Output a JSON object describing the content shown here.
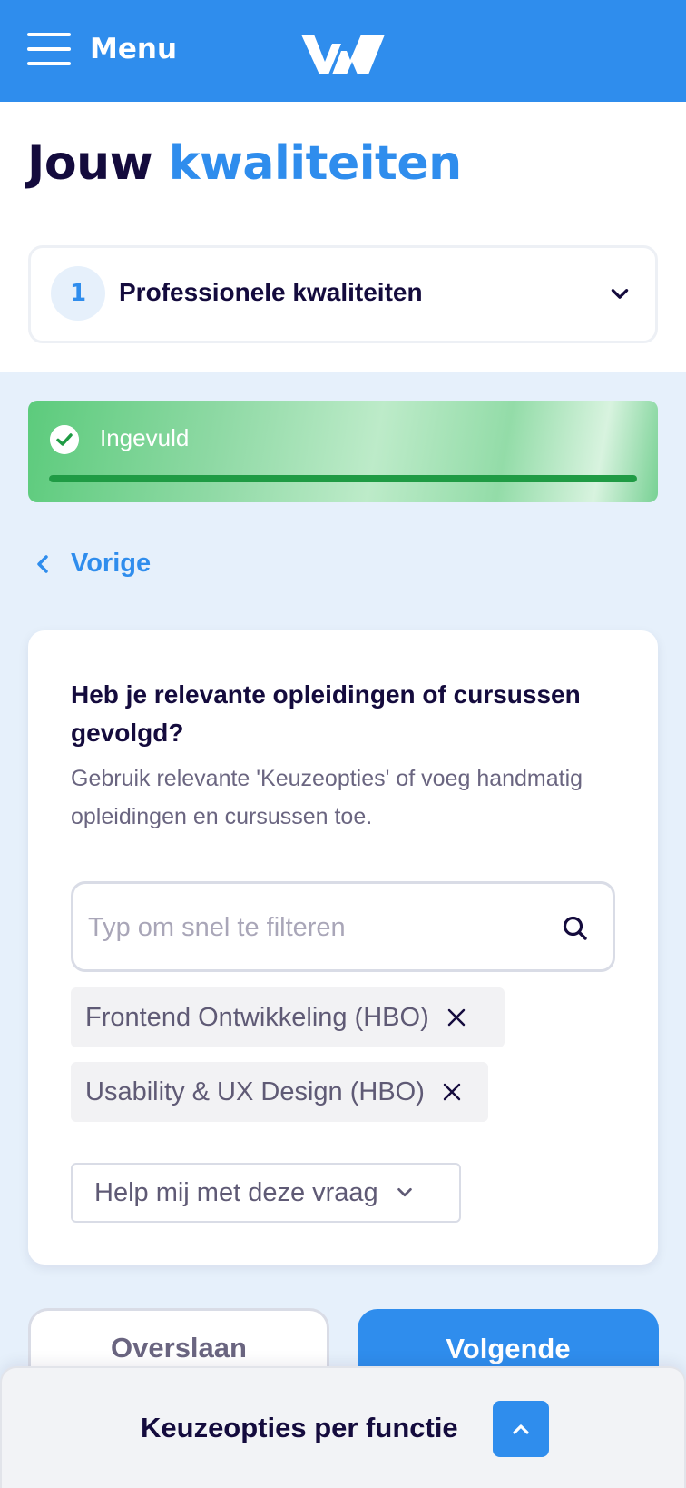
{
  "header": {
    "menu_label": "Menu",
    "menu_icon": "hamburger-icon",
    "logo": "brand-logo"
  },
  "page": {
    "title_part1": "Jouw",
    "title_part2": "kwaliteiten"
  },
  "step_selector": {
    "number": "1",
    "label": "Professionele kwaliteiten",
    "icon": "chevron-down-icon"
  },
  "status": {
    "label": "Ingevuld",
    "progress": 1.0,
    "icon": "check-circle-icon",
    "color": "#1f9b44"
  },
  "back": {
    "label": "Vorige",
    "icon": "chevron-left-icon"
  },
  "question": {
    "title": "Heb je relevante opleidingen of cursussen gevolgd?",
    "description": "Gebruik relevante 'Keuzeopties' of voeg handmatig opleidingen en cursussen toe.",
    "search_placeholder": "Typ om snel te filteren",
    "search_value": "",
    "search_icon": "search-icon",
    "selected": [
      "Frontend Ontwikkeling (HBO)",
      "Usability & UX Design (HBO)"
    ],
    "help_label": "Help mij met deze vraag"
  },
  "actions": {
    "skip_label": "Overslaan",
    "next_label": "Volgende"
  },
  "bottom_sheet": {
    "label": "Keuzeopties per functie",
    "icon": "chevron-up-icon"
  },
  "colors": {
    "primary": "#2f8ded",
    "navy": "#140b3d",
    "success": "#1f9b44",
    "background": "#e6f0fb"
  }
}
